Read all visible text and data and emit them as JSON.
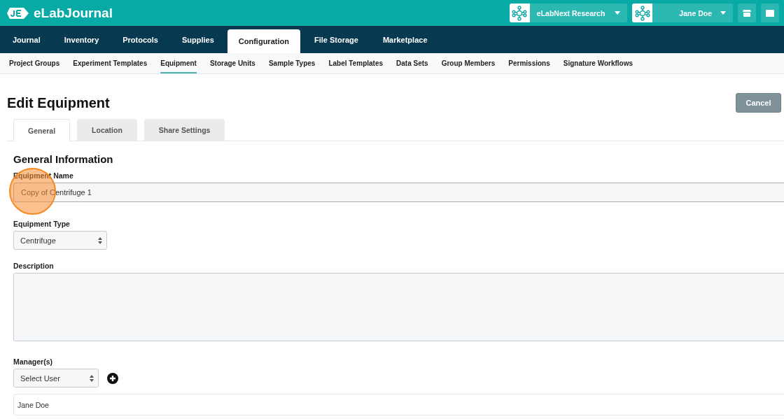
{
  "brand": {
    "name": "eLabJournal"
  },
  "account_menus": [
    {
      "label": "eLabNext Research"
    },
    {
      "label": "Jane Doe"
    }
  ],
  "nav_tabs": [
    {
      "label": "Journal",
      "selected": false
    },
    {
      "label": "Inventory",
      "selected": false
    },
    {
      "label": "Protocols",
      "selected": false
    },
    {
      "label": "Supplies",
      "selected": false
    },
    {
      "label": "Configuration",
      "selected": true
    },
    {
      "label": "File Storage",
      "selected": false
    },
    {
      "label": "Marketplace",
      "selected": false
    }
  ],
  "sub_nav": [
    {
      "label": "Project Groups",
      "selected": false
    },
    {
      "label": "Experiment Templates",
      "selected": false
    },
    {
      "label": "Equipment",
      "selected": true
    },
    {
      "label": "Storage Units",
      "selected": false
    },
    {
      "label": "Sample Types",
      "selected": false
    },
    {
      "label": "Label Templates",
      "selected": false
    },
    {
      "label": "Data Sets",
      "selected": false
    },
    {
      "label": "Group Members",
      "selected": false
    },
    {
      "label": "Permissions",
      "selected": false
    },
    {
      "label": "Signature Workflows",
      "selected": false
    }
  ],
  "page_title": "Edit Equipment",
  "cancel_button": "Cancel",
  "form_tabs": [
    {
      "label": "General",
      "selected": true
    },
    {
      "label": "Location",
      "selected": false
    },
    {
      "label": "Share Settings",
      "selected": false
    }
  ],
  "section_title": "General Information",
  "fields": [
    {
      "kind": "text",
      "label": "Equipment Name",
      "value": "Copy of Centrifuge 1"
    },
    {
      "kind": "select",
      "label": "Equipment Type",
      "value": "Centrifuge"
    },
    {
      "kind": "textarea",
      "label": "Description"
    },
    {
      "kind": "select-add",
      "label": "Manager(s)",
      "value": "Select User",
      "items": [
        "Jane Doe"
      ]
    }
  ]
}
